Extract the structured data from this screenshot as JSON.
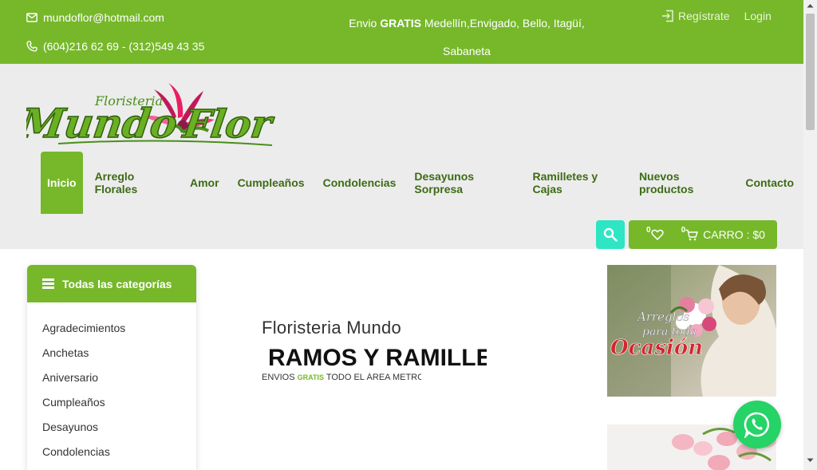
{
  "topbar": {
    "email": "mundoflor@hotmail.com",
    "phone": "(604)216 62 69 - (312)549 43 35",
    "shipping_prefix": "Envio ",
    "shipping_bold": "GRATIS",
    "shipping_rest": " Medellín,Envigado, Bello, Itagüí,",
    "shipping_line2": "Sabaneta",
    "register": "Regístrate",
    "login": "Login"
  },
  "logo": {
    "small": "Floristeria",
    "word1": "Mundo",
    "word2": "Flor"
  },
  "nav": {
    "items": [
      {
        "label": "Inicio"
      },
      {
        "label": "Arreglo Florales"
      },
      {
        "label": "Amor"
      },
      {
        "label": "Cumpleaños"
      },
      {
        "label": "Condolencias"
      },
      {
        "label": "Desayunos Sorpresa"
      },
      {
        "label": "Ramilletes y Cajas"
      },
      {
        "label": "Nuevos productos"
      },
      {
        "label": "Contacto"
      }
    ]
  },
  "cart": {
    "wish_count": "0",
    "cart_count": "0",
    "label": "CARRO : $0"
  },
  "sidebar": {
    "title": "Todas las categorías",
    "items": [
      {
        "label": "Agradecimientos"
      },
      {
        "label": "Anchetas"
      },
      {
        "label": "Aniversario"
      },
      {
        "label": "Cumpleaños"
      },
      {
        "label": "Desayunos"
      },
      {
        "label": "Condolencias"
      }
    ]
  },
  "hero": {
    "subtitle": "Floristeria Mundo",
    "title": "RAMOS Y RAMILLE",
    "note_prefix": "ENVIOS ",
    "note_green": "GRATIS",
    "note_rest": " TODO EL ÁREA METROF"
  },
  "banner1": {
    "line1": "Arreglos",
    "line2": "para toda",
    "line3": "Ocasión"
  },
  "colors": {
    "brand_green": "#76b82a",
    "dark_green": "#3d6b15",
    "search_teal": "#2ee5c4",
    "whatsapp": "#25d366"
  }
}
